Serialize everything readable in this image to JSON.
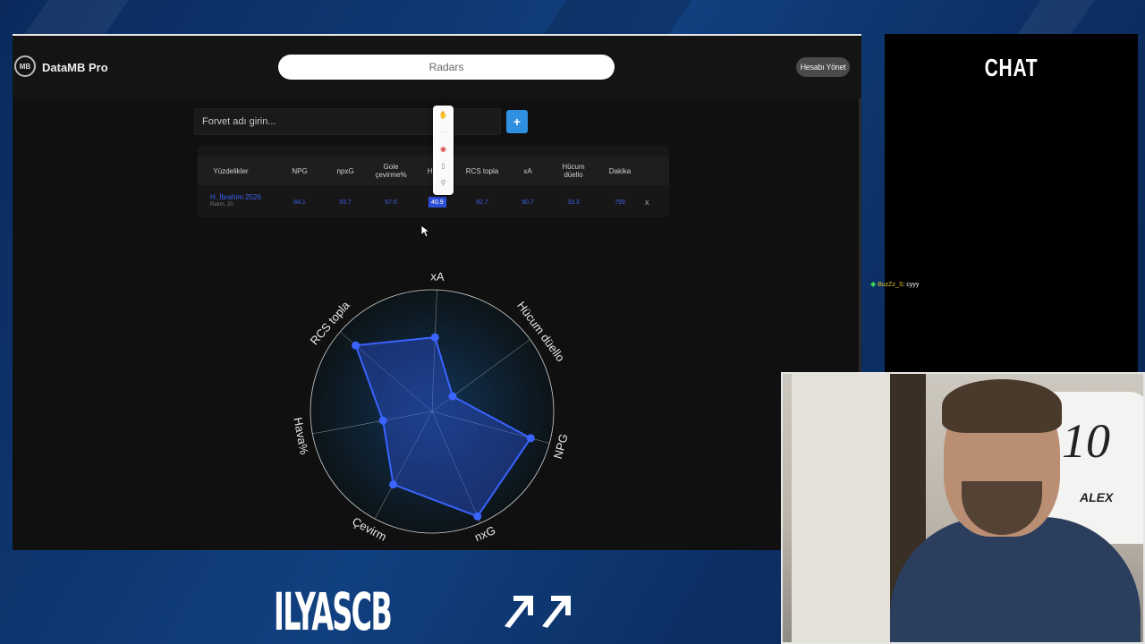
{
  "app": {
    "name": "DataMB Pro",
    "logo_text": "MB",
    "tab_title": "Radars",
    "account_button": "Hesabı Yönet"
  },
  "search": {
    "placeholder": "Forvet adı girin...",
    "add_button": "+"
  },
  "table": {
    "columns": [
      "Yüzdelikler",
      "NPG",
      "npxG",
      "Gole çevirme%",
      "Hava%",
      "RCS topla",
      "xA",
      "Hücum düello",
      "Dakika"
    ],
    "visible_columns": [
      "Yüzdelikler",
      "NPG",
      "npxG",
      "Gole\nçevirme%",
      "Ha",
      "RCS topla",
      "xA",
      "Hücum\ndüello",
      "Dakika"
    ],
    "row": {
      "player_name": "H. İbrahim 2526",
      "player_sub": "Rakm, 20",
      "values": [
        "84.1",
        "93.7",
        "67.6",
        "40.9",
        "82.7",
        "90.7",
        "33.3",
        "799"
      ],
      "highlighted_index": 3,
      "remove_label": "x"
    }
  },
  "chart_data": {
    "type": "radar",
    "axes": [
      "xA",
      "Hücum düello",
      "NPG",
      "npxG",
      "Gole çevirme%",
      "Hava%",
      "RCS topla"
    ],
    "visible_axis_labels": [
      "xA",
      "Hücum düello",
      "NPG",
      "nxG",
      "Çevirm",
      "Hava%",
      "RCS topla"
    ],
    "series": [
      {
        "values": [
          0.61,
          0.21,
          0.84,
          0.94,
          0.68,
          0.41,
          0.83
        ]
      }
    ],
    "range": [
      0,
      1
    ],
    "rings": 1,
    "spokes": 7,
    "colors": {
      "fill": "#2a4fd0",
      "stroke": "#3a63ff",
      "point": "#3a63ff",
      "grid": "#cfcfcf"
    }
  },
  "chat": {
    "title": "CHAT",
    "messages": [
      {
        "user": "BuzZz_S",
        "text": ": cyyy"
      }
    ]
  },
  "webcam": {
    "jersey_number": "10",
    "jersey_name": "ALEX"
  },
  "branding": {
    "channel": "ILYASCB"
  },
  "toolbar_icons": [
    "hand-icon",
    "dots-icon",
    "chrome-icon",
    "clipboard-icon",
    "search-icon"
  ]
}
